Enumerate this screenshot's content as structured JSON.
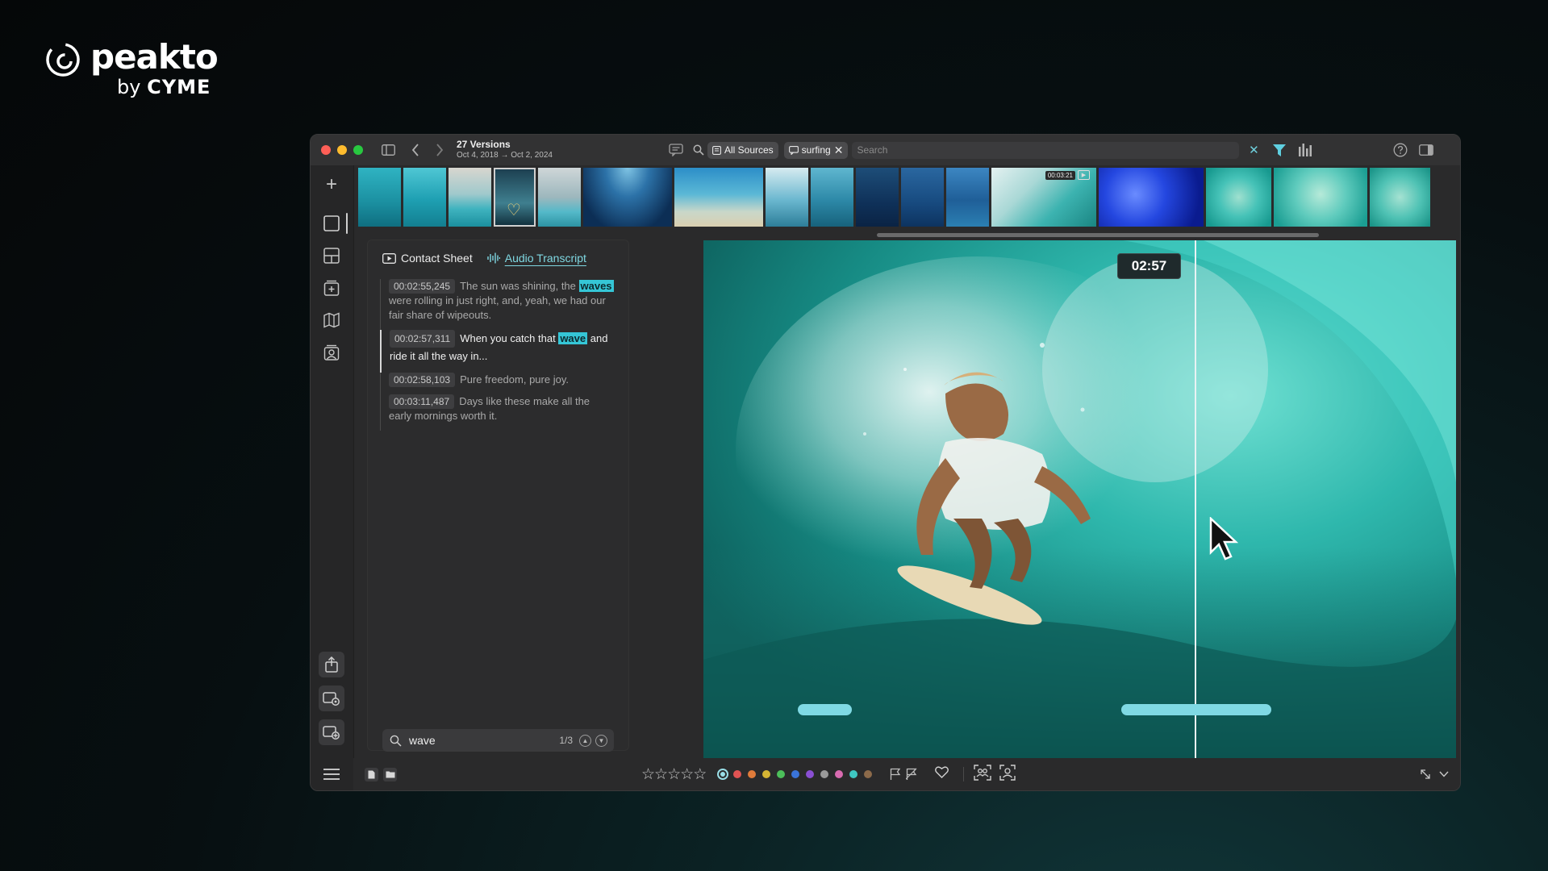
{
  "brand": {
    "name": "peakto",
    "by": "by",
    "maker": "CYME"
  },
  "titlebar": {
    "title": "27 Versions",
    "date_range": "Oct 4, 2018 → Oct 2, 2024",
    "source_chip": "All Sources",
    "tag_chip": "surfing",
    "search_placeholder": "Search"
  },
  "filmstrip": {
    "video_duration": "00:03:21",
    "thumb_count": 20
  },
  "panel": {
    "tabs": [
      {
        "label": "Contact Sheet",
        "icon": "play-rect-icon"
      },
      {
        "label": "Audio Transcript",
        "icon": "waveform-icon",
        "active": true
      }
    ],
    "transcript": [
      {
        "time": "00:02:55,245",
        "before": "The sun was shining, the ",
        "highlight": "waves",
        "after": " were rolling in just right, and, yeah, we had our fair share of wipeouts."
      },
      {
        "time": "00:02:57,311",
        "before": "When you catch that ",
        "highlight": "wave",
        "after": " and ride it all the way in...",
        "current": true
      },
      {
        "time": "00:02:58,103",
        "before": "Pure freedom, pure joy.",
        "highlight": "",
        "after": ""
      },
      {
        "time": "00:03:11,487",
        "before": "Days like these make all the early mornings worth it.",
        "highlight": "",
        "after": ""
      }
    ],
    "search": {
      "value": "wave",
      "count": "1/3"
    }
  },
  "viewer": {
    "timecode": "02:57"
  },
  "bottombar": {
    "rating_stars": 5,
    "color_labels": [
      "#e05353",
      "#e07b3a",
      "#d6b534",
      "#4cbf5a",
      "#3a74d9",
      "#8a4fd3",
      "#9a9a9a",
      "#d86bb0",
      "#3fc7c2",
      "#8c6a4a"
    ]
  },
  "colors": {
    "accent": "#7fd8e2",
    "highlight": "#35c6d6",
    "segment": "#7fd9e4"
  }
}
